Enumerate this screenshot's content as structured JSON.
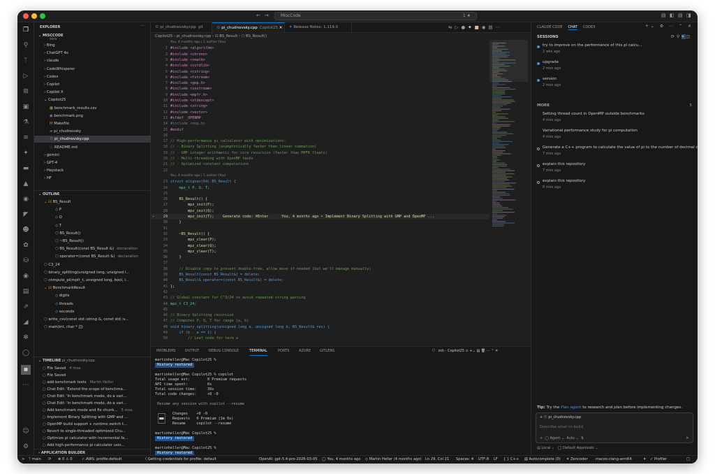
{
  "titlebar": {
    "search_text": "MiscCode",
    "branch_badge": "1"
  },
  "explorer": {
    "header": "EXPLORER",
    "workspace": "MISCCODE",
    "items": [
      {
        "label": "Bing",
        "type": "folder"
      },
      {
        "label": "ChatGPT 4o",
        "type": "folder"
      },
      {
        "label": "claude",
        "type": "folder"
      },
      {
        "label": "CodeWhisperer",
        "type": "folder"
      },
      {
        "label": "Codex",
        "type": "folder"
      },
      {
        "label": "Copilot",
        "type": "folder"
      },
      {
        "label": "Copilot X",
        "type": "folder"
      },
      {
        "label": "Copilot25",
        "type": "folder-open"
      },
      {
        "label": "benchmark_results.csv",
        "type": "file-csv"
      },
      {
        "label": "benchmark.png",
        "type": "file-img"
      },
      {
        "label": "Makefile",
        "type": "file-make"
      },
      {
        "label": "pi_chudnovsky",
        "type": "file-bin"
      },
      {
        "label": "pi_chudnovsky.cpp",
        "type": "file-cpp"
      },
      {
        "label": "README.md",
        "type": "file-md"
      },
      {
        "label": "gemini",
        "type": "folder"
      },
      {
        "label": "GPT-4",
        "type": "folder"
      },
      {
        "label": "Haystack",
        "type": "folder"
      },
      {
        "label": "HF",
        "type": "folder"
      }
    ]
  },
  "outline": {
    "header": "OUTLINE",
    "items": [
      {
        "label": "BS_Result",
        "detail": "",
        "indent": 1
      },
      {
        "label": "P",
        "detail": "",
        "indent": 2
      },
      {
        "label": "Q",
        "detail": "",
        "indent": 2
      },
      {
        "label": "T",
        "detail": "",
        "indent": 2
      },
      {
        "label": "BS_Result()",
        "detail": "",
        "indent": 2
      },
      {
        "label": "~BS_Result()",
        "detail": "",
        "indent": 2
      },
      {
        "label": "BS_Result(const BS_Result &)",
        "detail": "declaration",
        "indent": 2
      },
      {
        "label": "operator=(const BS_Result &)",
        "detail": "declaration",
        "indent": 2
      },
      {
        "label": "C3_24",
        "detail": "",
        "indent": 1
      },
      {
        "label": "binary_splitting(unsigned long, unsigned l...",
        "detail": "",
        "indent": 1
      },
      {
        "label": "compute_pi(mpfr_t, unsigned long, bool, i...",
        "detail": "",
        "indent": 1
      },
      {
        "label": "BenchmarkResult",
        "detail": "",
        "indent": 1
      },
      {
        "label": "digits",
        "detail": "",
        "indent": 2
      },
      {
        "label": "threads",
        "detail": "",
        "indent": 2
      },
      {
        "label": "seconds",
        "detail": "",
        "indent": 2
      },
      {
        "label": "write_csv(const std::string &, const std::v...",
        "detail": "",
        "indent": 1
      },
      {
        "label": "main(int, char * [])",
        "detail": "",
        "indent": 1
      }
    ]
  },
  "timeline": {
    "header": "TIMELINE",
    "file": "pi_chudnovsky.cpp",
    "items": [
      {
        "label": "File Saved",
        "time": "4 mos"
      },
      {
        "label": "File Saved",
        "time": ""
      },
      {
        "label": "add benchmark tests",
        "time": "Martin Heller"
      },
      {
        "label": "Chat Edit: 'Extend the scope of benchma...",
        "time": ""
      },
      {
        "label": "Chat Edit: 'In benchmark mode, do a vari...",
        "time": ""
      },
      {
        "label": "Chat Edit: 'In benchmark mode, do a vari...",
        "time": ""
      },
      {
        "label": "Add benchmark mode and fix chunk...",
        "time": "5 mos"
      },
      {
        "label": "Implement Binary Splitting with GMP and ...",
        "time": ""
      },
      {
        "label": "OpenMP build support + runtime switch t...",
        "time": ""
      },
      {
        "label": "Revert to single-threaded optimized Chu...",
        "time": ""
      },
      {
        "label": "Optimize pi calculator with incremental fa...",
        "time": ""
      },
      {
        "label": "Add high-performance pi calculator usin...",
        "time": ""
      }
    ],
    "app_builder": "APPLICATION BUILDER"
  },
  "tabs": [
    {
      "label": "pi_chudnovsky.cpp",
      "suffix": "git",
      "active": false
    },
    {
      "label": "pi_chudnovsky.cpp",
      "suffix": "Copilot25",
      "active": true
    },
    {
      "label": "Release Notes: 1.119.0",
      "suffix": "",
      "active": false
    }
  ],
  "breadcrumb": [
    "Copilot25",
    "pi_chudnovsky.cpp",
    "BS_Result",
    "BS_Result()"
  ],
  "code": [
    {
      "n": "",
      "t": "You, 4 months ago | 1 author (You)",
      "k": "blame"
    },
    {
      "n": "1",
      "t": "#include <algorithm>",
      "k": "inc"
    },
    {
      "n": "2",
      "t": "#include <chrono>",
      "k": "inc"
    },
    {
      "n": "3",
      "t": "#include <cmath>",
      "k": "inc"
    },
    {
      "n": "4",
      "t": "#include <cstdlib>",
      "k": "inc"
    },
    {
      "n": "5",
      "t": "#include <cstring>",
      "k": "inc"
    },
    {
      "n": "6",
      "t": "#include <fstream>",
      "k": "inc"
    },
    {
      "n": "7",
      "t": "#include <gmp.h>",
      "k": "inc"
    },
    {
      "n": "8",
      "t": "#include <iostream>",
      "k": "inc"
    },
    {
      "n": "9",
      "t": "#include <mpfr.h>",
      "k": "inc"
    },
    {
      "n": "10",
      "t": "#include <stdexcept>",
      "k": "inc"
    },
    {
      "n": "11",
      "t": "#include <string>",
      "k": "inc"
    },
    {
      "n": "12",
      "t": "#include <vector>",
      "k": "inc"
    },
    {
      "n": "13",
      "t": "#ifdef _OPENMP",
      "k": "inc"
    },
    {
      "n": "14",
      "t": "#include <omp.h>",
      "k": "dim"
    },
    {
      "n": "15",
      "t": "#endif",
      "k": "inc"
    },
    {
      "n": "16",
      "t": "",
      "k": ""
    },
    {
      "n": "17",
      "t": "// High-performance pi calculator with optimizations:",
      "k": "cmt"
    },
    {
      "n": "18",
      "t": "// - Binary Splitting (asymptotically faster than linear summation)",
      "k": "cmt"
    },
    {
      "n": "19",
      "t": "// - GMP integer arithmetic for core recursion (faster than MPFR floats)",
      "k": "cmt"
    },
    {
      "n": "20",
      "t": "// - Multi-threading with OpenMP tasks",
      "k": "cmt"
    },
    {
      "n": "21",
      "t": "// - Optimized constant computations",
      "k": "cmt"
    },
    {
      "n": "22",
      "t": "",
      "k": ""
    },
    {
      "n": "",
      "t": "You, 4 months ago | 1 author (You)",
      "k": "blame"
    },
    {
      "n": "23",
      "t": "struct alignas(64) BS_Result {",
      "k": "kw"
    },
    {
      "n": "24",
      "t": "    mpz_t P, Q, T;",
      "k": "typ"
    },
    {
      "n": "25",
      "t": "",
      "k": ""
    },
    {
      "n": "26",
      "t": "    BS_Result() {",
      "k": "fn"
    },
    {
      "n": "27",
      "t": "        mpz_init(P);",
      "k": "fn"
    },
    {
      "n": "28",
      "t": "        mpz_init(Q);",
      "k": "fn"
    },
    {
      "n": "29",
      "t": "        mpz_init(T);    Generate code: ⌘Enter      You, 4 months ago • Implement Binary Splitting with GMP and OpenMP ...",
      "k": "cur"
    },
    {
      "n": "30",
      "t": "    }",
      "k": "fn"
    },
    {
      "n": "31",
      "t": "",
      "k": ""
    },
    {
      "n": "32",
      "t": "    ~BS_Result() {",
      "k": "fn"
    },
    {
      "n": "33",
      "t": "        mpz_clear(P);",
      "k": "fn"
    },
    {
      "n": "34",
      "t": "        mpz_clear(Q);",
      "k": "fn"
    },
    {
      "n": "35",
      "t": "        mpz_clear(T);",
      "k": "fn"
    },
    {
      "n": "36",
      "t": "    }",
      "k": "fn"
    },
    {
      "n": "37",
      "t": "",
      "k": ""
    },
    {
      "n": "38",
      "t": "    // Disable copy to prevent double-free, allow move if needed (but we'll manage manually)",
      "k": "cmt"
    },
    {
      "n": "39",
      "t": "    BS_Result(const BS_Result&) = delete;",
      "k": "kw"
    },
    {
      "n": "40",
      "t": "    BS_Result& operator=(const BS_Result&) = delete;",
      "k": "kw"
    },
    {
      "n": "41",
      "t": "};",
      "k": "fn"
    },
    {
      "n": "42",
      "t": "",
      "k": ""
    },
    {
      "n": "43",
      "t": "// Global constant for C^3/24 to avoid repeated string parsing",
      "k": "cmt"
    },
    {
      "n": "44",
      "t": "mpz_t C3_24;",
      "k": "typ"
    },
    {
      "n": "45",
      "t": "",
      "k": ""
    },
    {
      "n": "46",
      "t": "// Binary Splitting recursion",
      "k": "cmt"
    },
    {
      "n": "47",
      "t": "// Computes P, Q, T for range [a, b)",
      "k": "cmt"
    },
    {
      "n": "48",
      "t": "void binary_splitting(unsigned long a, unsigned long b, BS_Result& res) {",
      "k": "kw"
    },
    {
      "n": "49",
      "t": "    if (b - a == 1) {",
      "k": "kw"
    },
    {
      "n": "50",
      "t": "        // Leaf node for term a",
      "k": "cmt"
    }
  ],
  "panel": {
    "tabs": [
      "PROBLEMS",
      "OUTPUT",
      "DEBUG CONSOLE",
      "TERMINAL",
      "PORTS",
      "AZURE",
      "GITLENS"
    ],
    "active_tab": "TERMINAL",
    "shell": "zsh - Copilot25",
    "lines": [
      {
        "t": "martinheller@Mac Copilot25 %",
        "k": "p"
      },
      {
        "t": " History restored ",
        "k": "hist"
      },
      {
        "t": "",
        "k": ""
      },
      {
        "t": "martinheller@Mac Copilot25 % copilot",
        "k": "p"
      },
      {
        "t": "Total usage est:        0 Premium requests",
        "k": ""
      },
      {
        "t": "API time spent:         0s",
        "k": ""
      },
      {
        "t": "Total session time:     39s",
        "k": ""
      },
      {
        "t": "Total code changes:     +0 -0",
        "k": ""
      },
      {
        "t": "",
        "k": ""
      },
      {
        "t": " Resume any session with copilot --resume",
        "k": "dim"
      },
      {
        "t": "",
        "k": ""
      },
      {
        "t": " ┌──┐   Changes    +0 -0",
        "k": ""
      },
      {
        "t": " │■■│   Requests   0 Premium (1m 0s)",
        "k": ""
      },
      {
        "t": " └──┘   Resume     copilot --resume",
        "k": ""
      },
      {
        "t": "",
        "k": ""
      },
      {
        "t": "martinheller@Mac Copilot25 %",
        "k": "p"
      },
      {
        "t": " History restored ",
        "k": "hist"
      },
      {
        "t": "",
        "k": ""
      },
      {
        "t": "martinheller@Mac Copilot25 %",
        "k": "p"
      },
      {
        "t": " History restored ",
        "k": "hist"
      }
    ]
  },
  "chat": {
    "tabs": [
      "CLAUDE CODE",
      "CHAT",
      "CODEX"
    ],
    "active_tab": "CHAT",
    "sessions_header": "SESSIONS",
    "sessions": [
      {
        "title": "try to improve on the performance of this pi calcu...",
        "time": "2 wks ago",
        "status": "blue"
      },
      {
        "title": "upgrade",
        "time": "2 mos ago",
        "status": "blue"
      },
      {
        "title": "version",
        "time": "2 mos ago",
        "status": "blue"
      }
    ],
    "more_header": "MORE",
    "more_count": "5",
    "more": [
      {
        "title": "Setting thread count in OpenMP outside benchmarks",
        "time": "4 mos ago",
        "status": "none"
      },
      {
        "title": "Variational performance study for pi computation",
        "time": "4 mos ago",
        "status": "none"
      },
      {
        "title": "Generate a C++ program to calculate the value of pi to the number of decimal di...",
        "time": "7 mos ago",
        "status": "grey"
      },
      {
        "title": "explain this repository",
        "time": "7 mos ago",
        "status": "grey"
      },
      {
        "title": "explain this repository",
        "time": "8 mos ago",
        "status": "grey"
      }
    ],
    "tip_prefix": "Tip:",
    "tip_text": "Try the",
    "tip_link": "Plan agent",
    "tip_suffix": "to research and plan before implementing changes.",
    "context_file": "pi_chudnovsky.cpp",
    "input_placeholder": "Describe what to build",
    "agent_label": "Agent",
    "model_label": "Auto",
    "local_label": "Local",
    "approvals_label": "Default Approvals"
  },
  "statusbar": {
    "branch": "main",
    "errors": "0",
    "warnings": "0",
    "aws": "AWS: profile:default",
    "credentials": "Getting credentials for profile: default",
    "openai": "OpenAI: gpt-5.4-pro-2026-03-05",
    "blame": "You, 4 months ago",
    "author": "Martin Heller (4 months ago)",
    "position": "Ln 29, Col 21",
    "spaces": "Spaces: 4",
    "encoding": "UTF-8",
    "eol": "LF",
    "language": "C++",
    "autocomplete": "Autocomplete (0)",
    "zencoder": "Zencoder",
    "compiler": "macos-clang-arm64",
    "profiler": "Profiler"
  }
}
